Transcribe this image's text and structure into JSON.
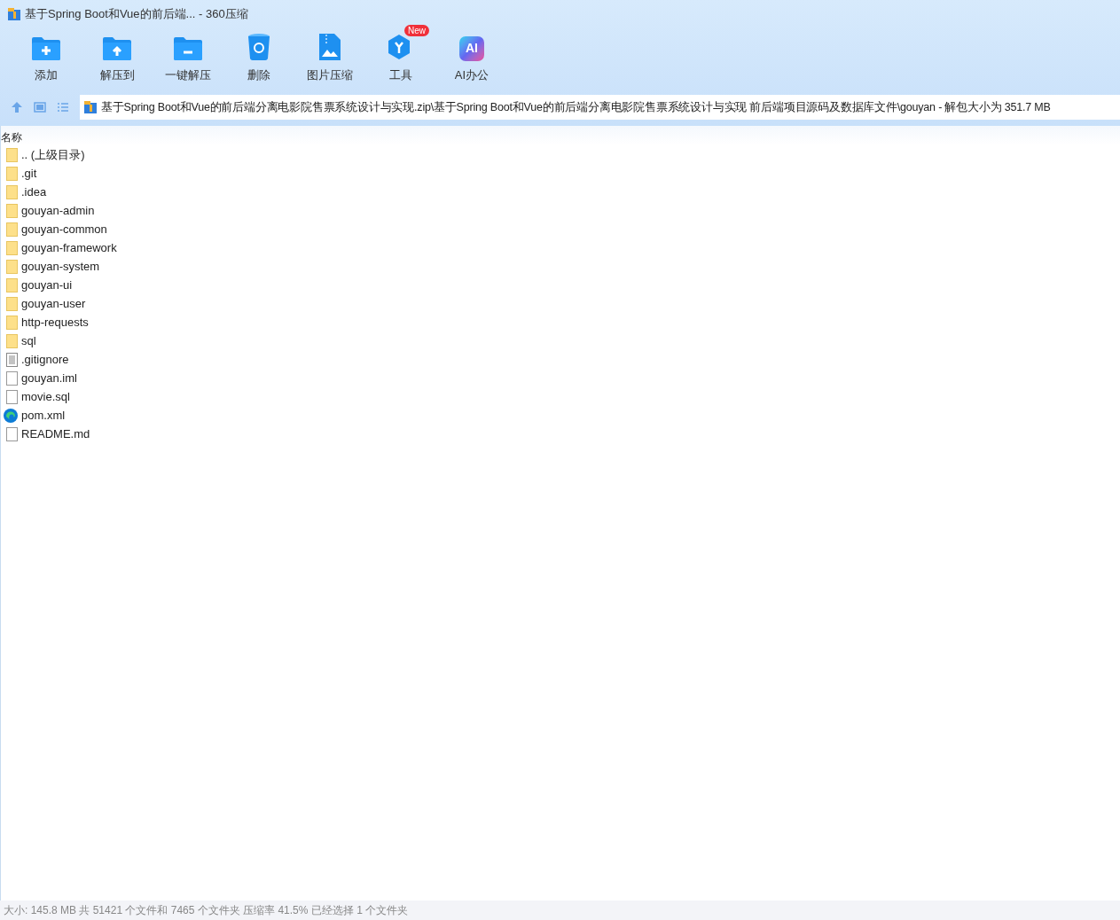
{
  "window": {
    "title": "基于Spring Boot和Vue的前后端... - 360压缩"
  },
  "toolbar": [
    {
      "kind": "add",
      "label": "添加"
    },
    {
      "kind": "extract",
      "label": "解压到"
    },
    {
      "kind": "oneclick",
      "label": "一键解压"
    },
    {
      "kind": "delete",
      "label": "删除"
    },
    {
      "kind": "image",
      "label": "图片压缩"
    },
    {
      "kind": "tools",
      "label": "工具",
      "badge": "New"
    },
    {
      "kind": "ai",
      "label": "AI办公",
      "icon_text": "AI"
    }
  ],
  "address": {
    "path": "基于Spring Boot和Vue的前后端分离电影院售票系统设计与实现.zip\\基于Spring Boot和Vue的前后端分离电影院售票系统设计与实现 前后端项目源码及数据库文件\\gouyan - 解包大小为 351.7 MB"
  },
  "table": {
    "columns": [
      "名称"
    ],
    "rows": [
      {
        "kind": "folder",
        "name": ".. (上级目录)"
      },
      {
        "kind": "folder",
        "name": ".git"
      },
      {
        "kind": "folder",
        "name": ".idea"
      },
      {
        "kind": "folder",
        "name": "gouyan-admin"
      },
      {
        "kind": "folder",
        "name": "gouyan-common"
      },
      {
        "kind": "folder",
        "name": "gouyan-framework"
      },
      {
        "kind": "folder",
        "name": "gouyan-system"
      },
      {
        "kind": "folder",
        "name": "gouyan-ui"
      },
      {
        "kind": "folder",
        "name": "gouyan-user"
      },
      {
        "kind": "folder",
        "name": "http-requests"
      },
      {
        "kind": "folder",
        "name": "sql"
      },
      {
        "kind": "text",
        "name": ".gitignore"
      },
      {
        "kind": "file",
        "name": "gouyan.iml"
      },
      {
        "kind": "file",
        "name": "movie.sql"
      },
      {
        "kind": "web",
        "name": "pom.xml"
      },
      {
        "kind": "file",
        "name": "README.md"
      }
    ]
  },
  "status_bar": "大小: 145.8 MB 共 51421 个文件和 7465 个文件夹 压缩率 41.5% 已经选择 1 个文件夹"
}
